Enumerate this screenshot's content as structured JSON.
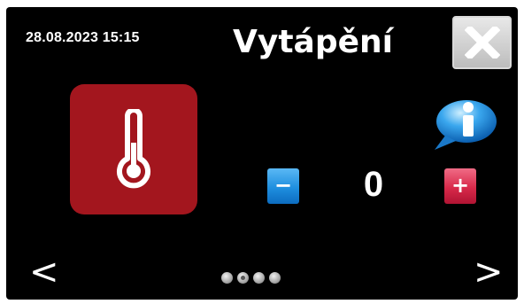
{
  "header": {
    "datetime": "28.08.2023 15:15",
    "title": "Vytápění",
    "close_icon": "close-icon"
  },
  "tile": {
    "icon": "thermometer-icon",
    "color": "#a3161e"
  },
  "info": {
    "icon": "info-bubble-icon"
  },
  "adjuster": {
    "value": "0",
    "minus_label": "−",
    "plus_label": "+"
  },
  "navigation": {
    "prev_label": "<",
    "next_label": ">",
    "page_count": 4,
    "active_page": 2
  }
}
